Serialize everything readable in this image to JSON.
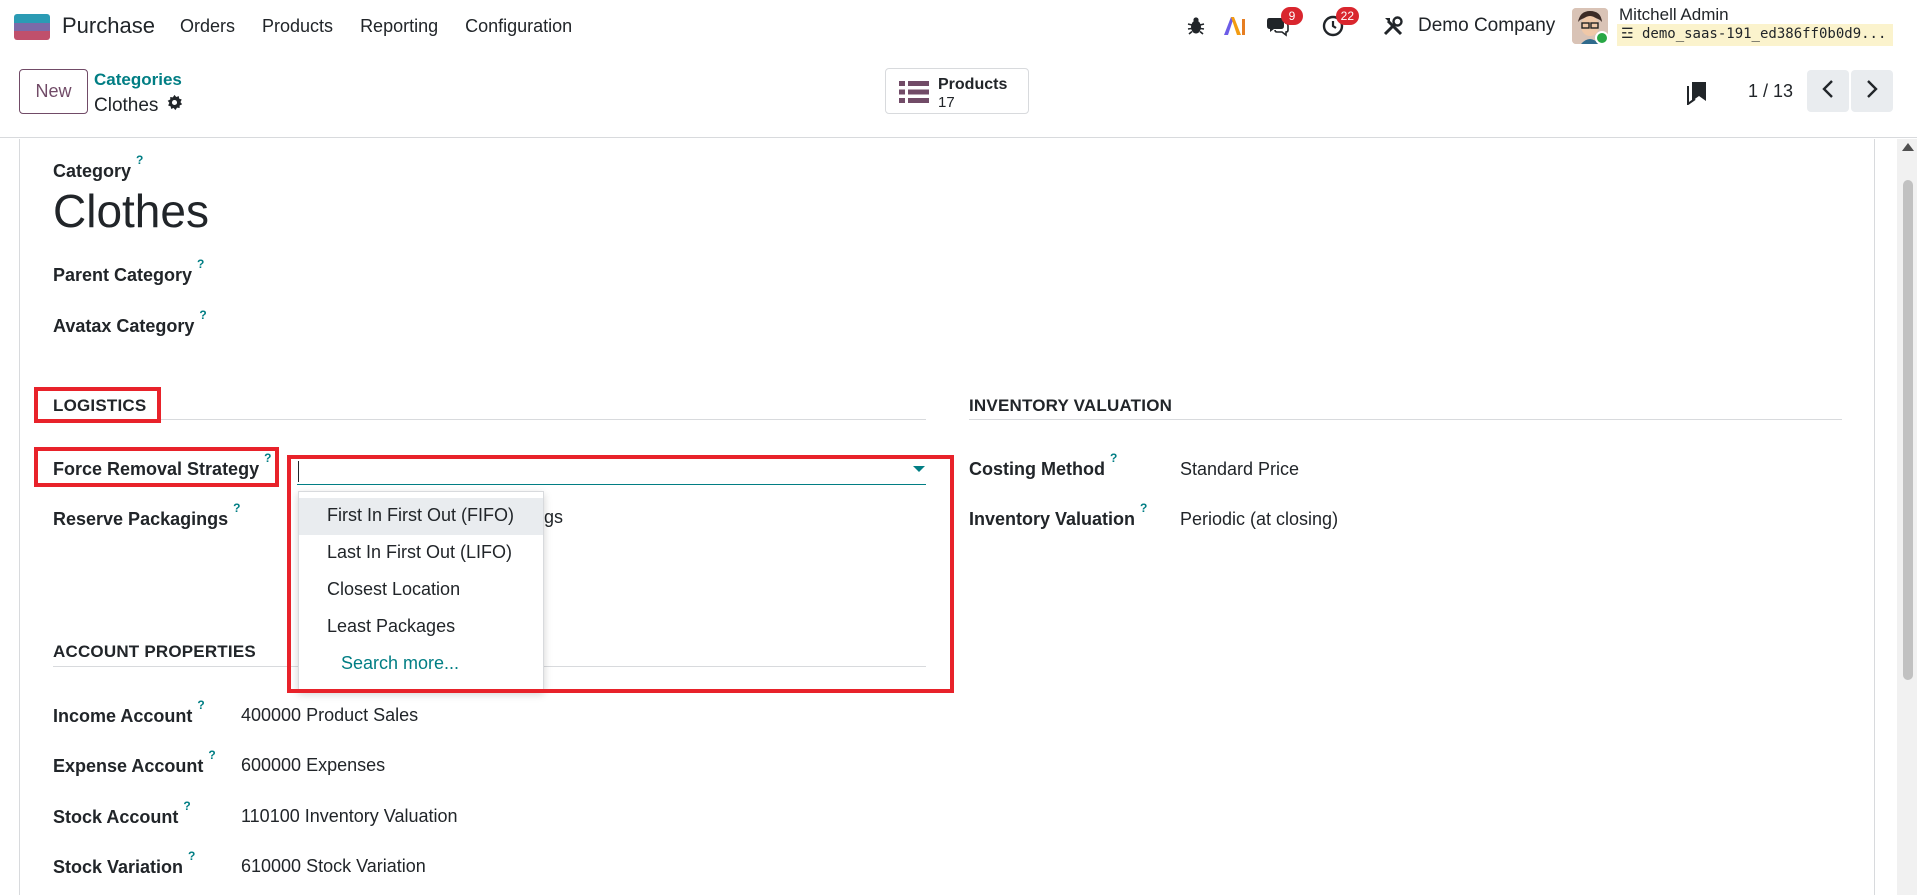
{
  "navbar": {
    "app_name": "Purchase",
    "menu": [
      "Orders",
      "Products",
      "Reporting",
      "Configuration"
    ],
    "messages_count": "9",
    "activities_count": "22",
    "company": "Demo Company",
    "user_name": "Mitchell Admin",
    "database": "demo_saas-191_ed386ff0b0d9..."
  },
  "control": {
    "new_label": "New",
    "breadcrumb_parent": "Categories",
    "breadcrumb_current": "Clothes",
    "smart_button_label": "Products",
    "smart_button_count": "17",
    "pager": "1 / 13"
  },
  "form": {
    "category_label": "Category",
    "category_name": "Clothes",
    "parent_category_label": "Parent Category",
    "avatax_category_label": "Avatax Category",
    "logistics": {
      "title": "LOGISTICS",
      "force_removal_label": "Force Removal Strategy",
      "force_removal_value": "",
      "reserve_packagings_label": "Reserve Packagings",
      "reserve_partial_1": "ngs",
      "reserve_partial_2": "s"
    },
    "dropdown": {
      "options": [
        "First In First Out (FIFO)",
        "Last In First Out (LIFO)",
        "Closest Location",
        "Least Packages"
      ],
      "search_more": "Search more..."
    },
    "inventory_valuation": {
      "title": "INVENTORY VALUATION",
      "costing_method_label": "Costing Method",
      "costing_method_value": "Standard Price",
      "inventory_valuation_label": "Inventory Valuation",
      "inventory_valuation_value": "Periodic (at closing)"
    },
    "account_properties": {
      "title": "ACCOUNT PROPERTIES",
      "rows": [
        {
          "label": "Income Account",
          "value": "400000 Product Sales"
        },
        {
          "label": "Expense Account",
          "value": "600000 Expenses"
        },
        {
          "label": "Stock Account",
          "value": "110100 Inventory Valuation"
        },
        {
          "label": "Stock Variation",
          "value": "610000 Stock Variation"
        }
      ]
    }
  },
  "colors": {
    "brand": "#714b67",
    "accent": "#017e84",
    "highlight": "#e8222a",
    "badge": "#d9262e"
  }
}
